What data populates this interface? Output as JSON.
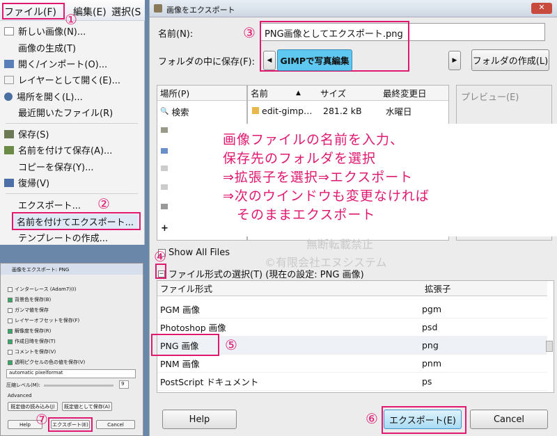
{
  "menu": {
    "bar": [
      "ファイル(F)",
      "編集(E)",
      "選択(S"
    ],
    "items": [
      "新しい画像(N)...",
      "画像の生成(T)",
      "開く/インポート(O)...",
      "レイヤーとして開く(E)...",
      "場所を開く(L)...",
      "最近開いたファイル(R)",
      "保存(S)",
      "名前を付けて保存(A)...",
      "コピーを保存(Y)...",
      "復帰(V)",
      "エクスポート...",
      "名前を付けてエクスポート...",
      "テンプレートの作成..."
    ]
  },
  "small": {
    "title": "画像をエクスポート: PNG",
    "options": [
      "インターレース (Adam7)(I)",
      "背景色を保存(B)",
      "ガンマ値を保存",
      "レイヤーオフセットを保存(F)",
      "解像度を保存(R)",
      "作成日時を保存(T)",
      "コメントを保存(V)",
      "透明ピクセルの色の値を保存(V)"
    ],
    "format": "automatic pixelformat",
    "compression_label": "圧縮レベル(M):",
    "compression_value": "9",
    "advanced": "Advanced",
    "load_defaults": "既定値の読み込み(J)",
    "save_defaults": "既定値として保存(A)",
    "help": "Help",
    "export": "エクスポート(E)",
    "cancel": "Cancel"
  },
  "dialog": {
    "title": "画像をエクスポート",
    "name_label": "名前(N):",
    "filename": "PNG画像としてエクスポート.png",
    "folder_label": "フォルダの中に保存(F):",
    "folder": "GIMPで写真編集",
    "create_folder": "フォルダの作成(L)",
    "places_header": "場所(P)",
    "places": [
      "検索"
    ],
    "col_name": "名前",
    "col_size": "サイズ",
    "col_modified": "最終変更日",
    "files": [
      {
        "name": "edit-gimp…",
        "size": "281.2 kB",
        "date": "水曜日"
      }
    ],
    "preview": "プレビュー(E)",
    "show_all": "Show All Files",
    "filetype_toggle": "ファイル形式の選択(T) (現在の設定: PNG 画像)",
    "type_header": "ファイル形式",
    "ext_header": "拡張子",
    "types": [
      {
        "name": "PGM 画像",
        "ext": "pgm"
      },
      {
        "name": "Photoshop 画像",
        "ext": "psd"
      },
      {
        "name": "PNG 画像",
        "ext": "png"
      },
      {
        "name": "PNM 画像",
        "ext": "pnm"
      },
      {
        "name": "PostScript ドキュメント",
        "ext": "ps"
      }
    ],
    "help": "Help",
    "export": "エクスポート(E)",
    "cancel": "Cancel"
  },
  "annotation": {
    "lines": [
      "画像ファイルの名前を入力、",
      "保存先のフォルダを選択",
      "⇒拡張子を選択⇒エクスポート",
      "⇒次のウインドウも変更なければ",
      "　そのままエクスポート"
    ],
    "markers": [
      "①",
      "②",
      "③",
      "④",
      "⑤",
      "⑥",
      "⑦"
    ]
  },
  "watermark": [
    "無断転載禁止",
    "©有限会社エヌシステム"
  ],
  "colors": {
    "accent": "#e01870",
    "selected_folder": "#5fc8f0"
  }
}
